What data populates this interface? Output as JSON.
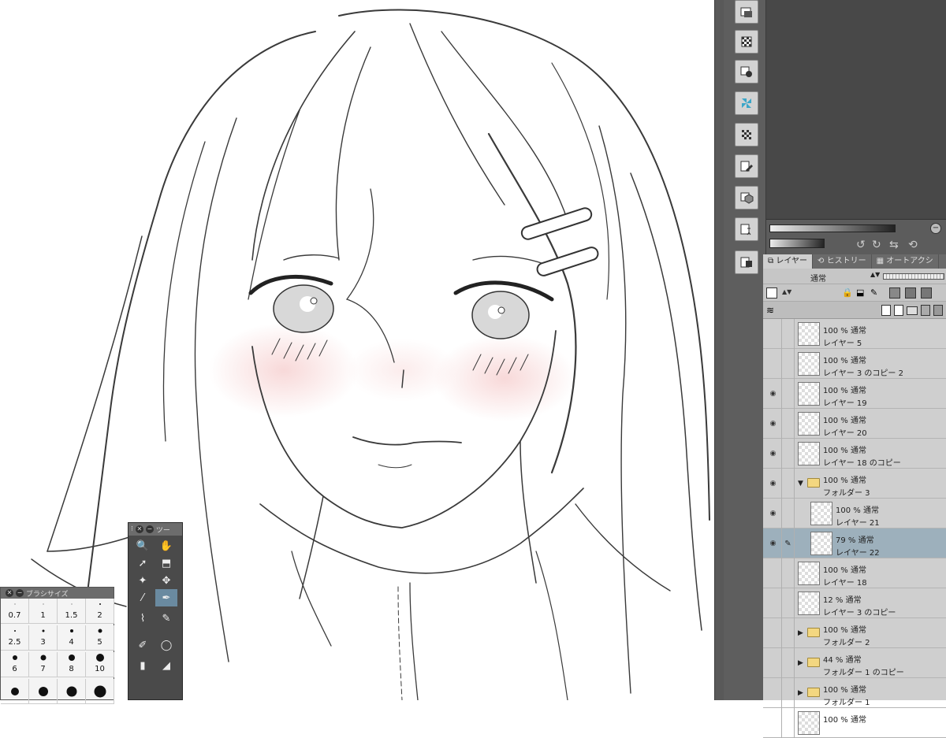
{
  "brush_window": {
    "title": "ブラシサイズ",
    "sizes": [
      {
        "label": "0.7",
        "dot": 1
      },
      {
        "label": "1",
        "dot": 1
      },
      {
        "label": "1.5",
        "dot": 1
      },
      {
        "label": "2",
        "dot": 2
      },
      {
        "label": "2.5",
        "dot": 2
      },
      {
        "label": "3",
        "dot": 3
      },
      {
        "label": "4",
        "dot": 4
      },
      {
        "label": "5",
        "dot": 5
      },
      {
        "label": "6",
        "dot": 6
      },
      {
        "label": "7",
        "dot": 7
      },
      {
        "label": "8",
        "dot": 8
      },
      {
        "label": "10",
        "dot": 10
      },
      {
        "label": "",
        "dot": 10
      },
      {
        "label": "",
        "dot": 12
      },
      {
        "label": "",
        "dot": 13
      },
      {
        "label": "",
        "dot": 15
      }
    ]
  },
  "tool_window": {
    "title": "ツー",
    "tools": [
      "zoom-icon",
      "hand-icon",
      "operation-icon",
      "object-icon",
      "auto-select-icon",
      "move-layer-icon",
      "eyedropper-icon",
      "pen-icon",
      "ink-icon",
      "brush-icon",
      "pencil-icon",
      "lasso-icon",
      "marker-icon",
      "eraser-icon"
    ]
  },
  "layer_panel": {
    "tabs": [
      "レイヤー",
      "ヒストリー",
      "オートアクシ"
    ],
    "blend_mode": "通常",
    "layers": [
      {
        "opacity": "100 % 通常",
        "name": "レイヤー 5",
        "visible": false,
        "type": "layer",
        "indent": false,
        "selected": false
      },
      {
        "opacity": "100 % 通常",
        "name": "レイヤー 3 のコピー 2",
        "visible": false,
        "type": "layer",
        "indent": false,
        "selected": false
      },
      {
        "opacity": "100 % 通常",
        "name": "レイヤー 19",
        "visible": true,
        "type": "layer",
        "indent": false,
        "selected": false
      },
      {
        "opacity": "100 % 通常",
        "name": "レイヤー 20",
        "visible": true,
        "type": "layer",
        "indent": false,
        "selected": false
      },
      {
        "opacity": "100 % 通常",
        "name": "レイヤー 18 のコピー",
        "visible": true,
        "type": "layer",
        "indent": false,
        "selected": false
      },
      {
        "opacity": "100 % 通常",
        "name": "フォルダー 3",
        "visible": true,
        "type": "folder-open",
        "indent": false,
        "selected": false
      },
      {
        "opacity": "100 % 通常",
        "name": "レイヤー 21",
        "visible": true,
        "type": "layer",
        "indent": true,
        "selected": false
      },
      {
        "opacity": "79 % 通常",
        "name": "レイヤー 22",
        "visible": true,
        "type": "layer",
        "indent": true,
        "selected": true
      },
      {
        "opacity": "100 % 通常",
        "name": "レイヤー 18",
        "visible": false,
        "type": "layer",
        "indent": false,
        "selected": false
      },
      {
        "opacity": "12 % 通常",
        "name": "レイヤー 3 のコピー",
        "visible": false,
        "type": "layer",
        "indent": false,
        "selected": false
      },
      {
        "opacity": "100 % 通常",
        "name": "フォルダー 2",
        "visible": false,
        "type": "folder",
        "indent": false,
        "selected": false
      },
      {
        "opacity": "44 % 通常",
        "name": "フォルダー 1 のコピー",
        "visible": false,
        "type": "folder",
        "indent": false,
        "selected": false
      },
      {
        "opacity": "100 % 通常",
        "name": "フォルダー 1",
        "visible": false,
        "type": "folder",
        "indent": false,
        "selected": false
      },
      {
        "opacity": "100 % 通常",
        "name": "",
        "visible": false,
        "type": "layer",
        "indent": false,
        "selected": false
      }
    ]
  }
}
